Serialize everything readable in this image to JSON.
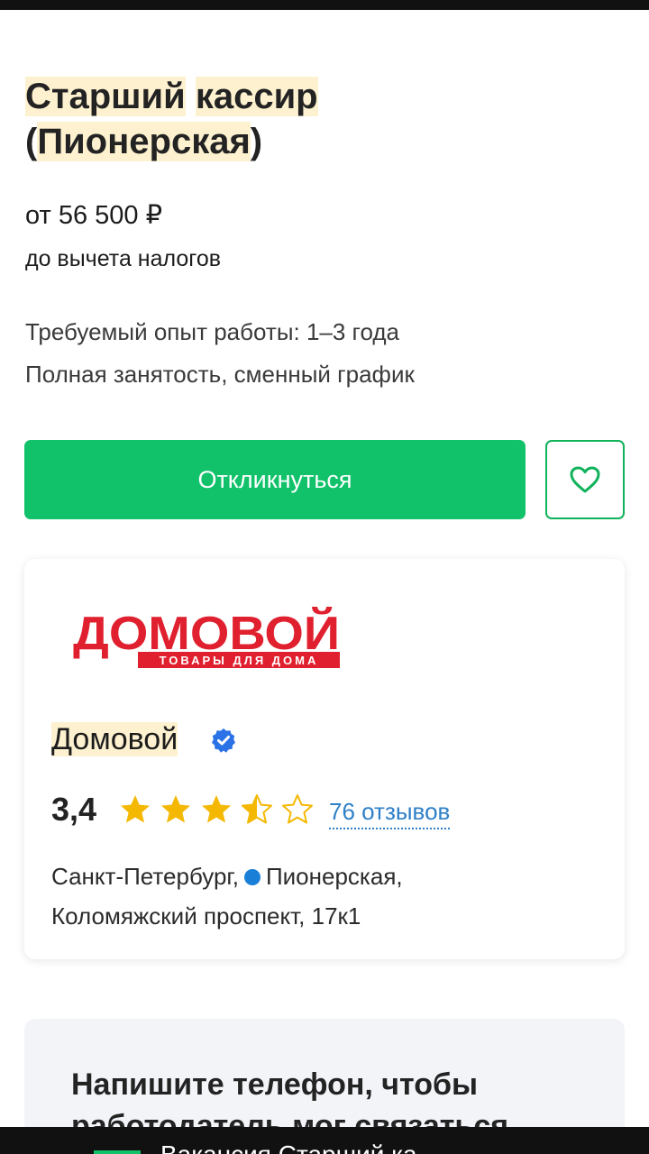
{
  "vacancy": {
    "title_words": [
      "Старший",
      "кассир",
      "Пионерская"
    ],
    "salary": "от 56 500 ₽",
    "salary_note": "до вычета налогов",
    "experience": "Требуемый опыт работы: 1–3 года",
    "schedule": "Полная занятость, сменный график"
  },
  "actions": {
    "apply_label": "Откликнуться",
    "favorite_icon": "heart-icon"
  },
  "company": {
    "logo_text": "ДОМОВОЙ",
    "logo_subtext": "ТОВАРЫ ДЛЯ ДОМА",
    "name": "Домовой",
    "verified_icon": "verified-icon",
    "rating": "3,4",
    "rating_value": 3.4,
    "rating_max": 5,
    "reviews": "76 отзывов",
    "city": "Санкт-Петербург,",
    "metro": "Пионерская,",
    "street": "Коломяжский проспект, 17к1"
  },
  "phone_prompt": {
    "title": "Напишите телефон, чтобы работодатель мог связаться"
  },
  "bottom_banner": {
    "text": "Вакансия Старший ка"
  },
  "colors": {
    "accent": "#11c26a",
    "highlight": "#fdf1cf",
    "link": "#2f80c8",
    "star": "#f5b800",
    "logo_red": "#e0202e"
  }
}
